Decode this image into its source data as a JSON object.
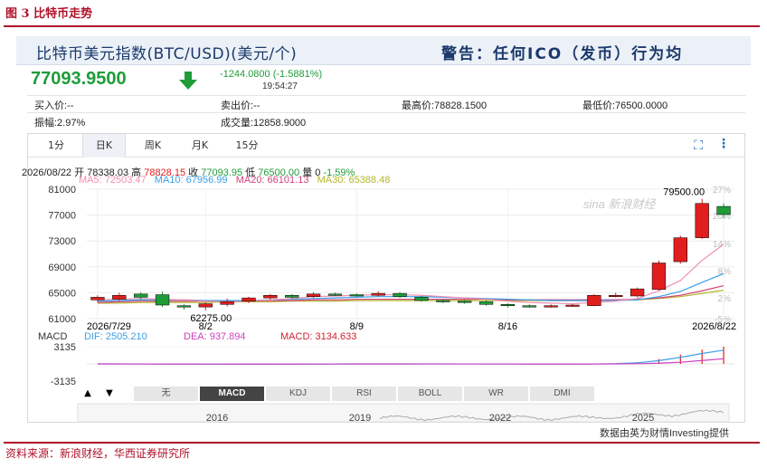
{
  "figure": {
    "title": "图 3 比特币走势",
    "source": "资料来源：新浪财经，华西证券研究所"
  },
  "header": {
    "title": "比特币美元指数(BTC/USD)(美元/个)",
    "warning": "警告：任何ICO（发币）行为均"
  },
  "quote": {
    "price": "77093.9500",
    "change": "-1244.0800 (-1.5881%)",
    "time": "19:54:27",
    "bid": "买入价:--",
    "ask": "卖出价:--",
    "high": "最高价:78828.1500",
    "low": "最低价:76500.0000",
    "amplitude": "振幅:2.97%",
    "volume": "成交量:12858.9000"
  },
  "tabs": [
    "1分",
    "日K",
    "周K",
    "月K",
    "15分"
  ],
  "active_tab": "日K",
  "ohlc_line": {
    "date": "2026/08/22",
    "open_label": "开",
    "open": "78338.03",
    "high_label": "高",
    "high": "78828.15",
    "close_label": "收",
    "close": "77093.95",
    "low_label": "低",
    "low": "76500.00",
    "vol_label": "量",
    "vol": "0",
    "pct": "-1.59%"
  },
  "ma_line": {
    "ma5": "MA5: 72503.47",
    "ma10": "MA10: 67956.99",
    "ma20": "MA20: 66101.13",
    "ma30": "MA30: 65388.48"
  },
  "colors": {
    "up": "#e01e1e",
    "down": "#1f9c3a",
    "ma5": "#f08fb0",
    "ma10": "#3aa0e8",
    "ma20": "#d0447a",
    "ma30": "#b5b52a",
    "brand": "#b0122a"
  },
  "chart_data": {
    "type": "candlestick",
    "y_ticks": [
      "81000",
      "77000",
      "73000",
      "69000",
      "65000",
      "61000"
    ],
    "pct_ticks": [
      "27%",
      "20%",
      "14%",
      "8%",
      "2%",
      "-5%"
    ],
    "x_ticks": [
      "2026/7/29",
      "8/2",
      "8/9",
      "8/16",
      "2026/8/22"
    ],
    "annotations": {
      "max": "79500.00",
      "min": "62275.00"
    },
    "candles": [
      {
        "o": 63900,
        "c": 64300,
        "h": 64600,
        "l": 63500
      },
      {
        "o": 64000,
        "c": 64600,
        "h": 65000,
        "l": 63700
      },
      {
        "o": 64800,
        "c": 64300,
        "h": 65100,
        "l": 63900
      },
      {
        "o": 64700,
        "c": 63100,
        "h": 65200,
        "l": 62800
      },
      {
        "o": 63000,
        "c": 62800,
        "h": 63200,
        "l": 62400
      },
      {
        "o": 62800,
        "c": 63300,
        "h": 63500,
        "l": 62275
      },
      {
        "o": 63200,
        "c": 63600,
        "h": 64100,
        "l": 62900
      },
      {
        "o": 63700,
        "c": 64200,
        "h": 64400,
        "l": 63400
      },
      {
        "o": 64200,
        "c": 64600,
        "h": 64800,
        "l": 63900
      },
      {
        "o": 64600,
        "c": 64300,
        "h": 64800,
        "l": 64000
      },
      {
        "o": 64400,
        "c": 64800,
        "h": 65100,
        "l": 64200
      },
      {
        "o": 64800,
        "c": 64700,
        "h": 65000,
        "l": 64500
      },
      {
        "o": 64700,
        "c": 64600,
        "h": 64900,
        "l": 64400
      },
      {
        "o": 64600,
        "c": 64900,
        "h": 65200,
        "l": 64400
      },
      {
        "o": 64900,
        "c": 64400,
        "h": 65100,
        "l": 64200
      },
      {
        "o": 64300,
        "c": 63800,
        "h": 64500,
        "l": 63600
      },
      {
        "o": 63800,
        "c": 63700,
        "h": 64000,
        "l": 63400
      },
      {
        "o": 63700,
        "c": 63600,
        "h": 63900,
        "l": 63300
      },
      {
        "o": 63600,
        "c": 63200,
        "h": 63900,
        "l": 63000
      },
      {
        "o": 63200,
        "c": 63000,
        "h": 63400,
        "l": 62700
      },
      {
        "o": 63000,
        "c": 62900,
        "h": 63200,
        "l": 62700
      },
      {
        "o": 62900,
        "c": 63000,
        "h": 63200,
        "l": 62700
      },
      {
        "o": 63000,
        "c": 63100,
        "h": 63300,
        "l": 62800
      },
      {
        "o": 63000,
        "c": 64600,
        "h": 64800,
        "l": 62900
      },
      {
        "o": 64500,
        "c": 64600,
        "h": 65000,
        "l": 64300
      },
      {
        "o": 64500,
        "c": 65600,
        "h": 65800,
        "l": 64300
      },
      {
        "o": 65500,
        "c": 69600,
        "h": 70000,
        "l": 65300
      },
      {
        "o": 69800,
        "c": 73500,
        "h": 73800,
        "l": 69500
      },
      {
        "o": 73500,
        "c": 78800,
        "h": 79500,
        "l": 73300
      },
      {
        "o": 78338,
        "c": 77093,
        "h": 78828,
        "l": 76500
      }
    ],
    "ma5": [
      63900,
      64000,
      64100,
      64000,
      63900,
      63700,
      63600,
      63700,
      63900,
      64100,
      64400,
      64500,
      64600,
      64700,
      64700,
      64600,
      64400,
      64200,
      64000,
      63700,
      63500,
      63400,
      63300,
      63500,
      63700,
      64100,
      65300,
      66900,
      70000,
      72500
    ],
    "ma10": [
      63700,
      63800,
      63900,
      63900,
      63900,
      63800,
      63800,
      63800,
      63900,
      64000,
      64100,
      64200,
      64300,
      64400,
      64400,
      64400,
      64300,
      64200,
      64100,
      64000,
      63900,
      63800,
      63800,
      63800,
      63800,
      63900,
      64400,
      65200,
      66600,
      67957
    ],
    "ma20": [
      63500,
      63600,
      63700,
      63700,
      63700,
      63700,
      63700,
      63700,
      63800,
      63800,
      63900,
      63900,
      64000,
      64000,
      64000,
      64000,
      64000,
      64000,
      64000,
      63900,
      63900,
      63900,
      63900,
      63900,
      63900,
      64000,
      64200,
      64600,
      65300,
      66101
    ],
    "ma30": [
      63400,
      63400,
      63500,
      63500,
      63500,
      63500,
      63600,
      63600,
      63600,
      63700,
      63700,
      63700,
      63800,
      63800,
      63800,
      63800,
      63800,
      63800,
      63800,
      63800,
      63800,
      63800,
      63800,
      63800,
      63900,
      63900,
      64100,
      64400,
      64900,
      65388
    ],
    "macd_legend": {
      "title": "MACD",
      "dif": "DIF: 2505.210",
      "dea": "DEA: 937.894",
      "macd": "MACD: 3134.633"
    },
    "macd_ticks": [
      "3135",
      "-3135"
    ],
    "macd": [
      0,
      -10,
      -20,
      -30,
      -40,
      -50,
      -40,
      -30,
      -20,
      -10,
      0,
      5,
      10,
      15,
      10,
      5,
      0,
      -5,
      -10,
      -15,
      -20,
      -25,
      -20,
      0,
      60,
      300,
      900,
      1700,
      2600,
      3134
    ],
    "dif": [
      0,
      -10,
      -20,
      -30,
      -40,
      -50,
      -50,
      -45,
      -40,
      -30,
      -20,
      -10,
      0,
      5,
      5,
      0,
      -5,
      -10,
      -15,
      -20,
      -25,
      -30,
      -25,
      -10,
      40,
      200,
      600,
      1200,
      1900,
      2505
    ],
    "dea": [
      0,
      -5,
      -10,
      -15,
      -20,
      -30,
      -35,
      -40,
      -40,
      -38,
      -35,
      -30,
      -25,
      -20,
      -15,
      -12,
      -10,
      -10,
      -12,
      -14,
      -16,
      -18,
      -20,
      -20,
      -10,
      30,
      120,
      300,
      620,
      938
    ]
  },
  "indicators": [
    "无",
    "MACD",
    "KDJ",
    "RSI",
    "BOLL",
    "WR",
    "DMI"
  ],
  "active_indicator": "MACD",
  "timeline_years": [
    "2016",
    "2019",
    "2022",
    "2025"
  ],
  "footer": "数据由英为财情Investing提供",
  "watermark": "sina 新浪财经"
}
